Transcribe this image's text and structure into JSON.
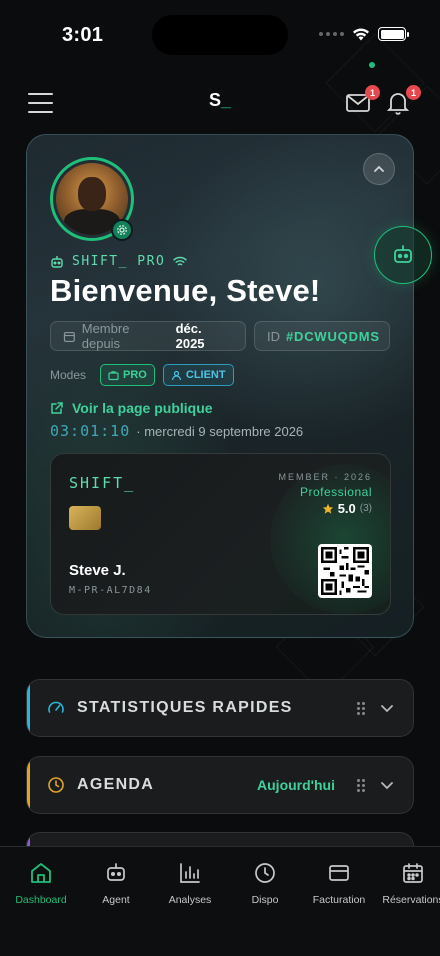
{
  "status_bar": {
    "time": "3:01"
  },
  "header": {
    "brand_text": "S",
    "brand_suffix": "_",
    "mail_badge": "1",
    "bell_badge": "1"
  },
  "profile": {
    "company": "SHIFT_ PRO",
    "welcome": "Bienvenue, Steve!",
    "member_since_label": "Membre depuis",
    "member_since_value": "déc. 2025",
    "id_label": "ID",
    "id_value": "#DCWUQDMS",
    "modes_label": "Modes",
    "modes": [
      "PRO",
      "CLIENT"
    ],
    "public_link": "Voir la page publique",
    "clock": "03:01:10",
    "date": "· mercredi 9 septembre 2026"
  },
  "member_card": {
    "brand": "SHIFT_",
    "member_year": "MEMBER · 2026",
    "tier": "Professional",
    "rating": "5.0",
    "rating_count": "(3)",
    "name": "Steve J.",
    "code": "M-PR-AL7D84"
  },
  "sections": [
    {
      "title": "STATISTIQUES RAPIDES",
      "accent": "#2bb6d6"
    },
    {
      "title": "AGENDA",
      "link": "Aujourd'hui",
      "accent": "#e0a527"
    }
  ],
  "bottom_nav": [
    {
      "label": "Dashboard",
      "icon": "home-icon",
      "active": true
    },
    {
      "label": "Agent",
      "icon": "robot-icon"
    },
    {
      "label": "Analyses",
      "icon": "bar-chart-icon"
    },
    {
      "label": "Dispo",
      "icon": "clock-icon"
    },
    {
      "label": "Facturation",
      "icon": "card-icon"
    },
    {
      "label": "Réservations",
      "icon": "calendar-icon"
    }
  ],
  "colors": {
    "accent_green": "#1fbf7a",
    "accent_teal": "#2bb6d6",
    "accent_gold": "#e0a527",
    "badge_red": "#e5484d"
  }
}
